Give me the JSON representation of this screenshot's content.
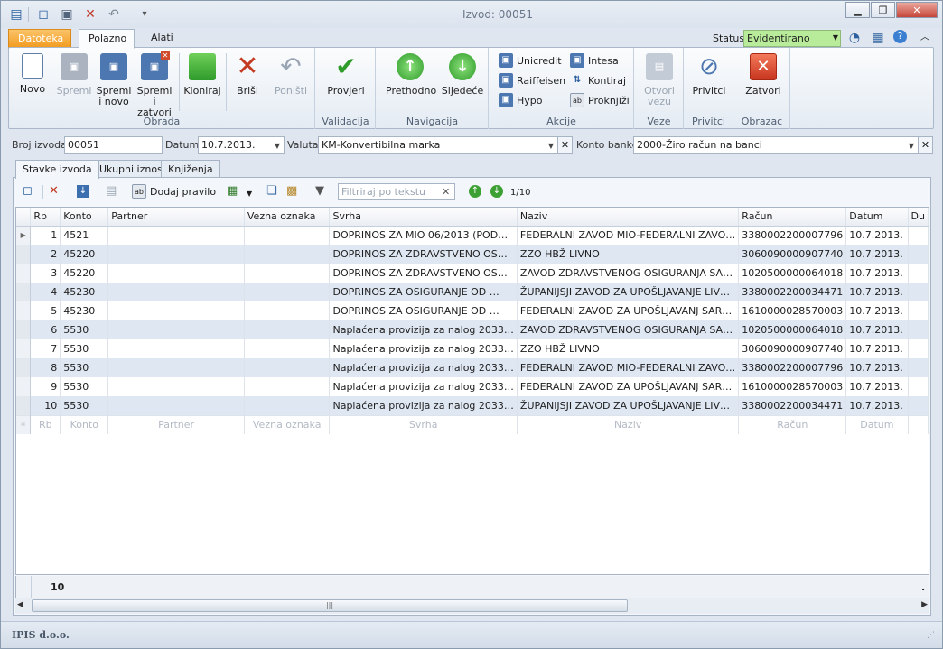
{
  "window": {
    "title": "Izvod: 00051"
  },
  "ribbon_tabs": [
    "Datoteka",
    "Polazno",
    "Alati"
  ],
  "status": {
    "label": "Status",
    "value": "Evidentirano"
  },
  "groups": {
    "obrada": {
      "label": "Obrada",
      "novo": "Novo",
      "spremi": "Spremi",
      "spremi_novo": [
        "Spremi",
        "i novo"
      ],
      "spremi_zatvori": [
        "Spremi i",
        "zatvori"
      ],
      "kloniraj": "Kloniraj",
      "brisi": "Briši",
      "ponisti": "Poništi"
    },
    "validacija": {
      "label": "Validacija",
      "provjeri": "Provjeri"
    },
    "navigacija": {
      "label": "Navigacija",
      "prethodno": "Prethodno",
      "sljedece": "Sljedeće"
    },
    "akcije": {
      "label": "Akcije",
      "unicredit": "Unicredit",
      "raiffeisen": "Raiffeisen",
      "hypo": "Hypo",
      "intesa": "Intesa",
      "kontiraj": "Kontiraj",
      "proknjizi": "Proknjiži"
    },
    "veze": {
      "label": "Veze",
      "otvori": [
        "Otvori",
        "vezu"
      ]
    },
    "privitci": {
      "label": "Privitci",
      "btn": "Privitci"
    },
    "obrazac": {
      "label": "Obrazac",
      "zatvori": "Zatvori"
    }
  },
  "form": {
    "broj_label": "Broj izvoda",
    "broj": "00051",
    "datum_label": "Datum",
    "datum": "10.7.2013.",
    "valuta_label": "Valuta",
    "valuta": "KM-Konvertibilna marka",
    "konto_label": "Konto banke",
    "konto": "2000-Žiro račun na banci"
  },
  "page_tabs": [
    "Stavke izvoda",
    "Ukupni iznosi",
    "Knjiženja"
  ],
  "grid_toolbar": {
    "dodaj_pravilo": "Dodaj pravilo",
    "filter_placeholder": "Filtriraj po tekstu",
    "pager": "1/10"
  },
  "columns": [
    "Rb",
    "Konto",
    "Partner",
    "Vezna oznaka",
    "Svrha",
    "Naziv",
    "Račun",
    "Datum",
    "Du"
  ],
  "rows": [
    {
      "rb": "1",
      "konto": "4521",
      "partner": "",
      "vezna": "",
      "svrha": "DOPRINOS ZA MIO 06/2013 (POD…",
      "naziv": "FEDERALNI ZAVOD MIO-FEDERALNI ZAVO…",
      "racun": "3380002200007796",
      "datum": "10.7.2013."
    },
    {
      "rb": "2",
      "konto": "45220",
      "partner": "",
      "vezna": "",
      "svrha": "DOPRINOS ZA ZDRAVSTVENO OS…",
      "naziv": "ZZO HBŽ                    LIVNO",
      "racun": "3060090000907740",
      "datum": "10.7.2013."
    },
    {
      "rb": "3",
      "konto": "45220",
      "partner": "",
      "vezna": "",
      "svrha": "DOPRINOS ZA ZDRAVSTVENO OS…",
      "naziv": "ZAVOD ZDRAVSTVENOG OSIGURANJA  SA…",
      "racun": "1020500000064018",
      "datum": "10.7.2013."
    },
    {
      "rb": "4",
      "konto": "45230",
      "partner": "",
      "vezna": "",
      "svrha": "DOPRINOS ZA OSIGURANJE OD …",
      "naziv": "ŽUPANIJSJI ZAVOD ZA UPOŠLJAVANJE LIV…",
      "racun": "3380002200034471",
      "datum": "10.7.2013."
    },
    {
      "rb": "5",
      "konto": "45230",
      "partner": "",
      "vezna": "",
      "svrha": "DOPRINOS ZA OSIGURANJE OD …",
      "naziv": "FEDERALNI ZAVOD ZA UPOŠLJAVANJ SAR…",
      "racun": "1610000028570003",
      "datum": "10.7.2013."
    },
    {
      "rb": "6",
      "konto": "5530",
      "partner": "",
      "vezna": "",
      "svrha": "Naplaćena provizija za nalog 2033…",
      "naziv": "ZAVOD ZDRAVSTVENOG OSIGURANJA  SA…",
      "racun": "1020500000064018",
      "datum": "10.7.2013."
    },
    {
      "rb": "7",
      "konto": "5530",
      "partner": "",
      "vezna": "",
      "svrha": "Naplaćena provizija za nalog 2033…",
      "naziv": "ZZO HBŽ                    LIVNO",
      "racun": "3060090000907740",
      "datum": "10.7.2013."
    },
    {
      "rb": "8",
      "konto": "5530",
      "partner": "",
      "vezna": "",
      "svrha": "Naplaćena provizija za nalog 2033…",
      "naziv": "FEDERALNI ZAVOD MIO-FEDERALNI ZAVO…",
      "racun": "3380002200007796",
      "datum": "10.7.2013."
    },
    {
      "rb": "9",
      "konto": "5530",
      "partner": "",
      "vezna": "",
      "svrha": "Naplaćena provizija za nalog 2033…",
      "naziv": "FEDERALNI ZAVOD ZA UPOŠLJAVANJ SAR…",
      "racun": "1610000028570003",
      "datum": "10.7.2013."
    },
    {
      "rb": "10",
      "konto": "5530",
      "partner": "",
      "vezna": "",
      "svrha": "Naplaćena provizija za nalog 2033…",
      "naziv": "ŽUPANIJSJI ZAVOD ZA UPOŠLJAVANJE LIV…",
      "racun": "3380002200034471",
      "datum": "10.7.2013."
    }
  ],
  "footer": {
    "count": "10"
  },
  "statusbar": {
    "company": "IPIS d.o.o."
  },
  "colors": {
    "accent_tab": "#f6a12a",
    "status_green": "#b8ec9a",
    "row_alt": "#dfe7f2"
  }
}
